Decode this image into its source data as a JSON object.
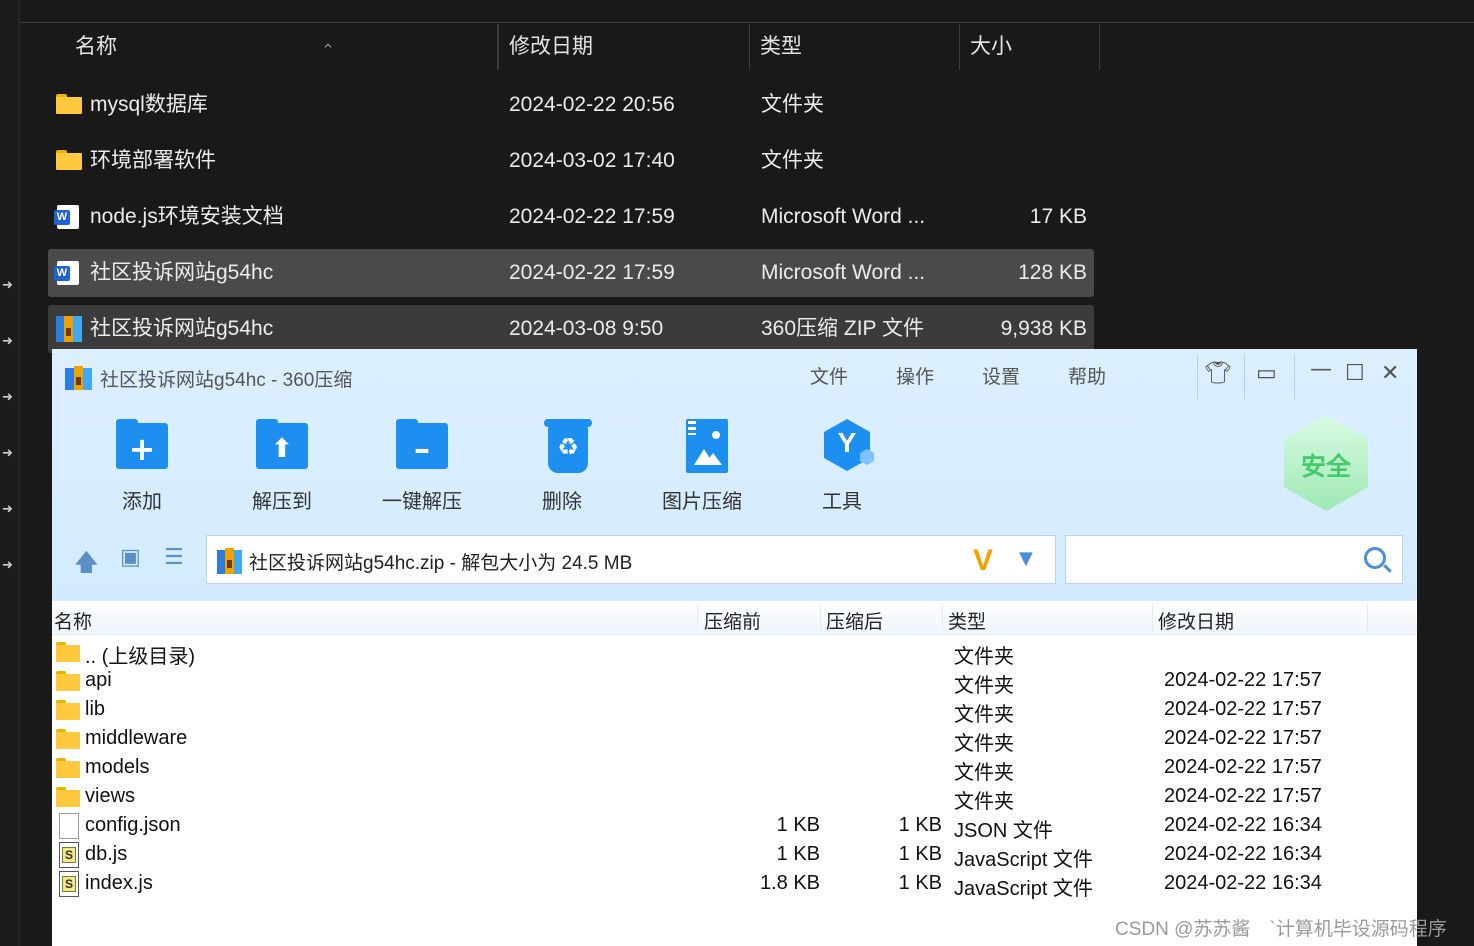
{
  "explorer": {
    "columns": {
      "name": "名称",
      "modified": "修改日期",
      "type": "类型",
      "size": "大小"
    },
    "rows": [
      {
        "name": "mysql数据库",
        "modified": "2024-02-22 20:56",
        "type": "文件夹",
        "size": "",
        "icon": "folder-icon"
      },
      {
        "name": "环境部署软件",
        "modified": "2024-03-02 17:40",
        "type": "文件夹",
        "size": "",
        "icon": "folder-icon"
      },
      {
        "name": "node.js环境安装文档",
        "modified": "2024-02-22 17:59",
        "type": "Microsoft Word ...",
        "size": "17 KB",
        "icon": "word-doc-icon"
      },
      {
        "name": "社区投诉网站g54hc",
        "modified": "2024-02-22 17:59",
        "type": "Microsoft Word ...",
        "size": "128 KB",
        "icon": "word-doc-icon"
      },
      {
        "name": "社区投诉网站g54hc",
        "modified": "2024-03-08 9:50",
        "type": "360压缩 ZIP 文件",
        "size": "9,938 KB",
        "icon": "zip-archive-icon"
      }
    ]
  },
  "archiver": {
    "title": "社区投诉网站g54hc - 360压缩",
    "menu": {
      "file": "文件",
      "operate": "操作",
      "settings": "设置",
      "help": "帮助"
    },
    "toolbar": {
      "add": "添加",
      "extract_to": "解压到",
      "one_click_extract": "一键解压",
      "delete": "删除",
      "image_compress": "图片压缩",
      "tools": "工具"
    },
    "safe_badge": "安全",
    "address": "社区投诉网站g54hc.zip - 解包大小为 24.5 MB",
    "search_value": "",
    "list_columns": {
      "name": "名称",
      "before": "压缩前",
      "after": "压缩后",
      "type": "类型",
      "modified": "修改日期"
    },
    "rows": [
      {
        "name": ".. (上级目录)",
        "before": "",
        "after": "",
        "type": "文件夹",
        "modified": "",
        "icon": "folder-icon"
      },
      {
        "name": "api",
        "before": "",
        "after": "",
        "type": "文件夹",
        "modified": "2024-02-22 17:57",
        "icon": "folder-icon"
      },
      {
        "name": "lib",
        "before": "",
        "after": "",
        "type": "文件夹",
        "modified": "2024-02-22 17:57",
        "icon": "folder-icon"
      },
      {
        "name": "middleware",
        "before": "",
        "after": "",
        "type": "文件夹",
        "modified": "2024-02-22 17:57",
        "icon": "folder-icon"
      },
      {
        "name": "models",
        "before": "",
        "after": "",
        "type": "文件夹",
        "modified": "2024-02-22 17:57",
        "icon": "folder-icon"
      },
      {
        "name": "views",
        "before": "",
        "after": "",
        "type": "文件夹",
        "modified": "2024-02-22 17:57",
        "icon": "folder-icon"
      },
      {
        "name": "config.json",
        "before": "1 KB",
        "after": "1 KB",
        "type": "JSON 文件",
        "modified": "2024-02-22 16:34",
        "icon": "file-icon"
      },
      {
        "name": "db.js",
        "before": "1 KB",
        "after": "1 KB",
        "type": "JavaScript 文件",
        "modified": "2024-02-22 16:34",
        "icon": "js-file-icon"
      },
      {
        "name": "index.js",
        "before": "1.8 KB",
        "after": "1 KB",
        "type": "JavaScript 文件",
        "modified": "2024-02-22 16:34",
        "icon": "js-file-icon"
      }
    ]
  },
  "watermark": "CSDN @苏苏酱　`计算机毕设源码程序"
}
